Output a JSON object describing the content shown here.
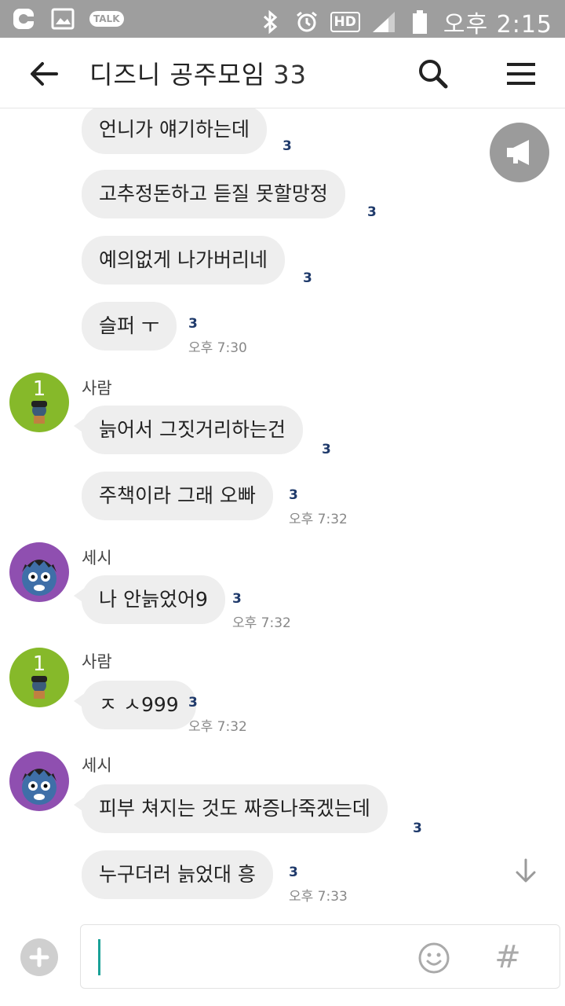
{
  "status_bar": {
    "time": "오후 2:15",
    "talk_label": "TALK",
    "hd_label": "HD",
    "icons": [
      "o-icon",
      "image-icon",
      "talk-icon",
      "bluetooth-icon",
      "alarm-icon",
      "hd-icon",
      "signal-icon",
      "battery-icon"
    ]
  },
  "header": {
    "title": "디즈니 공주모임",
    "member_count": "33",
    "icons": [
      "back-arrow-icon",
      "search-icon",
      "menu-icon"
    ]
  },
  "notice_icon": "megaphone-icon",
  "messages": [
    {
      "text": "언니가 얘기하는데",
      "unread": "3",
      "time": ""
    },
    {
      "text": "고추정돈하고 듣질 못할망정",
      "unread": "3",
      "time": ""
    },
    {
      "text": "예의없게 나가버리네",
      "unread": "3",
      "time": ""
    },
    {
      "text": "슬퍼 ㅜ",
      "unread": "3",
      "time": "오후 7:30"
    },
    {
      "sender": "사람",
      "avatar_number": "1",
      "text": "늙어서 그짓거리하는건",
      "unread": "3",
      "time": ""
    },
    {
      "text": "주책이라 그래 오빠",
      "unread": "3",
      "time": "오후 7:32"
    },
    {
      "sender": "세시",
      "text": "나 안늙었어9",
      "unread": "3",
      "time": "오후 7:32"
    },
    {
      "sender": "사람",
      "avatar_number": "1",
      "text": "ㅈ ㅅ999",
      "unread": "3",
      "time": "오후 7:32"
    },
    {
      "sender": "세시",
      "text": "피부 쳐지는 것도 짜증나죽겠는데",
      "unread": "3",
      "time": ""
    },
    {
      "text": "누구더러 늙었대 흥",
      "unread": "3",
      "time": "오후 7:33"
    }
  ],
  "input": {
    "value": "",
    "icons": [
      "plus-icon",
      "emoji-icon",
      "hash-icon"
    ],
    "hash_label": "#"
  },
  "colors": {
    "status_bar": "#9e9e9e",
    "bubble": "#eeeeee",
    "unread": "#1f3a6b",
    "avatar_green": "#86b92a",
    "avatar_purple": "#8f4fb0",
    "caret": "#1aa197"
  }
}
